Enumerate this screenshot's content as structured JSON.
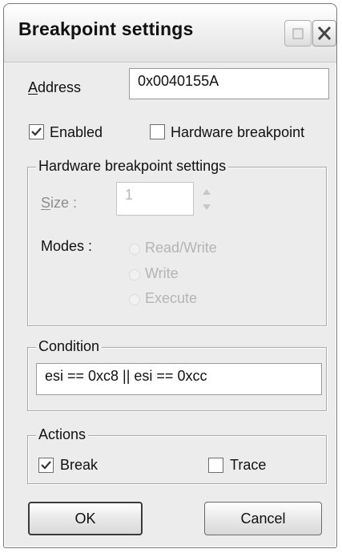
{
  "window": {
    "title": "Breakpoint settings",
    "min_icon": "restore-icon",
    "close_icon": "close-icon"
  },
  "address": {
    "label_first": "A",
    "label_rest": "ddress",
    "value": "0x0040155A"
  },
  "enabled": {
    "label": "Enabled",
    "checked": true
  },
  "hardware": {
    "label": "Hardware breakpoint",
    "checked": false
  },
  "hw_settings": {
    "caption": "Hardware breakpoint settings",
    "size_label_first": "S",
    "size_label_rest": "ize :",
    "size_value": "1",
    "modes_label": "Modes :",
    "modes": [
      "Read/Write",
      "Write",
      "Execute"
    ]
  },
  "condition": {
    "caption": "Condition",
    "value": "esi == 0xc8 || esi == 0xcc"
  },
  "actions": {
    "caption": "Actions",
    "break_label": "Break",
    "break_checked": true,
    "trace_label": "Trace",
    "trace_checked": false
  },
  "buttons": {
    "ok": "OK",
    "cancel": "Cancel"
  },
  "colors": {
    "dialog_bg": "#ececec",
    "disabled_text": "#b4b4b4"
  }
}
